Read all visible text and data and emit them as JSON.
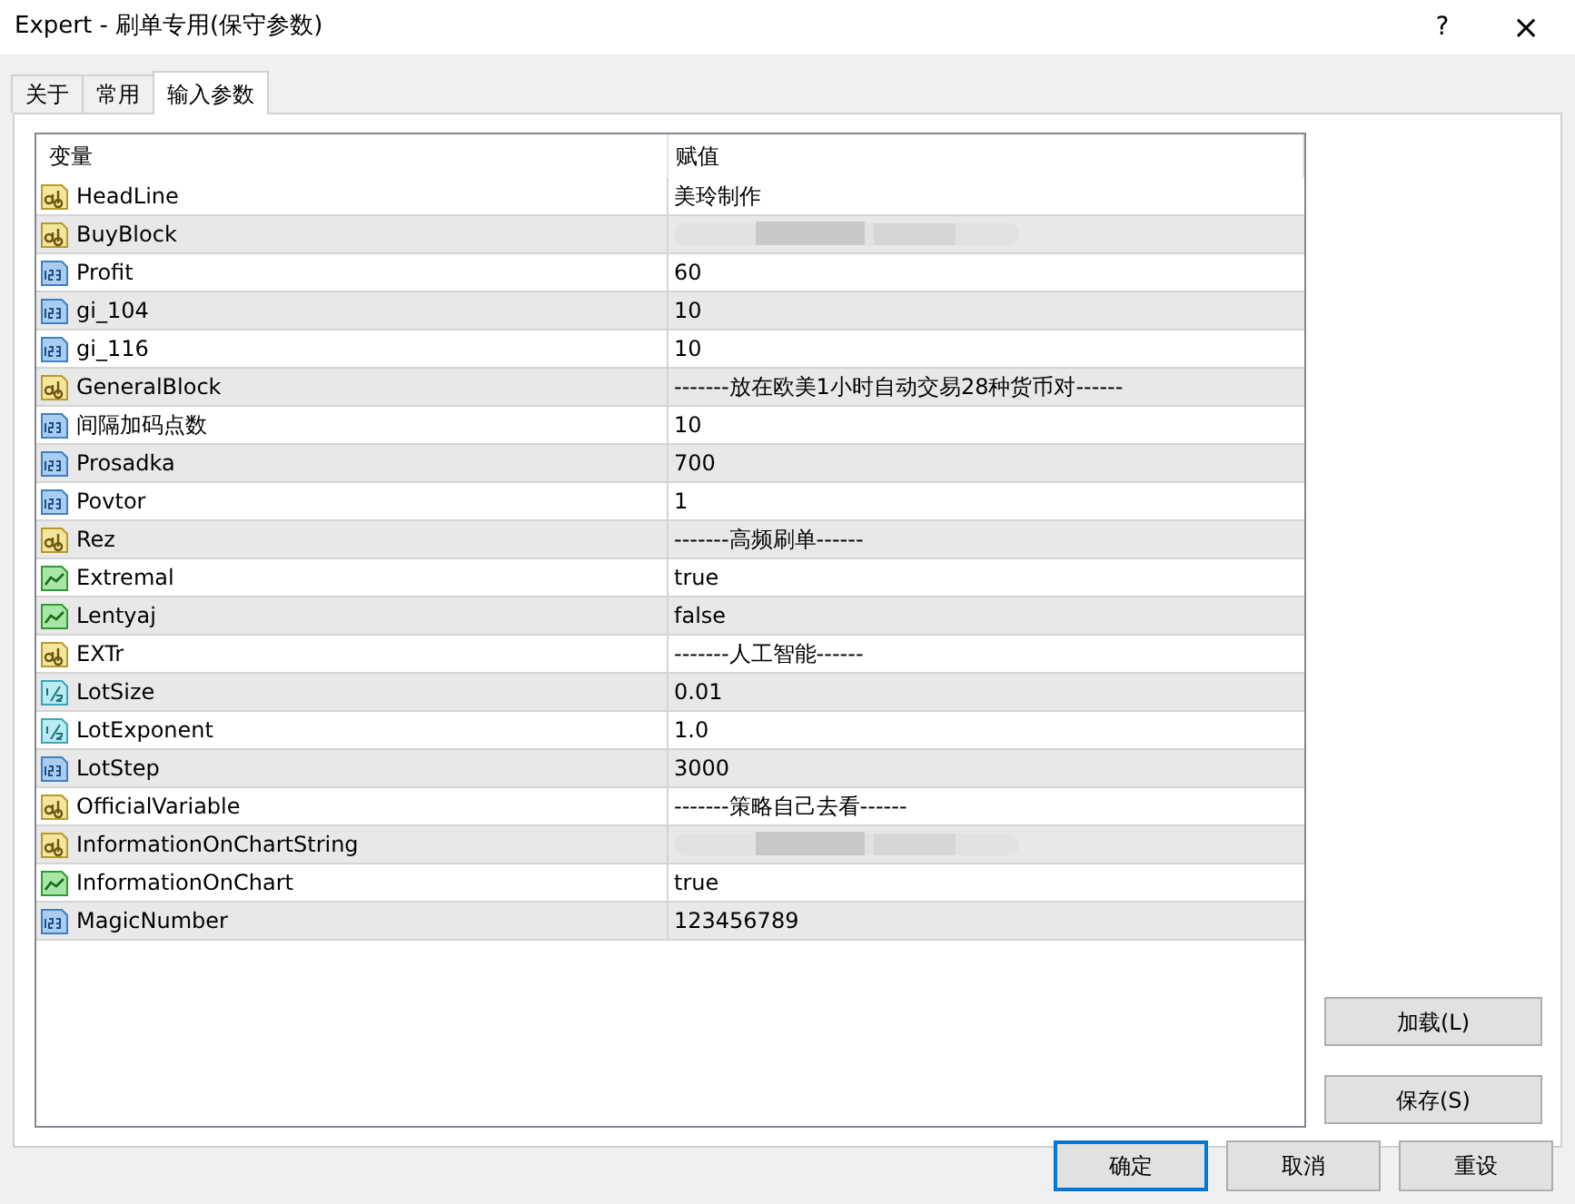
{
  "window": {
    "title": "Expert - 刷单专用(保守参数)",
    "help": "?",
    "close": "×"
  },
  "tabs": [
    {
      "label": "关于",
      "selected": false
    },
    {
      "label": "常用",
      "selected": false
    },
    {
      "label": "输入参数",
      "selected": true
    }
  ],
  "table": {
    "columns": [
      "变量",
      "赋值"
    ],
    "rows": [
      {
        "kind": "string",
        "name": "HeadLine",
        "value": "美玲制作"
      },
      {
        "kind": "string",
        "name": "BuyBlock",
        "redacted": true
      },
      {
        "kind": "int",
        "name": "Profit",
        "value": "60"
      },
      {
        "kind": "int",
        "name": "gi_104",
        "value": "10"
      },
      {
        "kind": "int",
        "name": "gi_116",
        "value": "10"
      },
      {
        "kind": "string",
        "name": "GeneralBlock",
        "value": "-------放在欧美1小时自动交易28种货币对------"
      },
      {
        "kind": "int",
        "name": "间隔加码点数",
        "value": "10"
      },
      {
        "kind": "int",
        "name": "Prosadka",
        "value": "700"
      },
      {
        "kind": "int",
        "name": "Povtor",
        "value": "1"
      },
      {
        "kind": "string",
        "name": "Rez",
        "value": "-------高频刷单------"
      },
      {
        "kind": "bool",
        "name": "Extremal",
        "value": "true"
      },
      {
        "kind": "bool",
        "name": "Lentyaj",
        "value": "false"
      },
      {
        "kind": "string",
        "name": "EXTr",
        "value": "-------人工智能------"
      },
      {
        "kind": "double",
        "name": "LotSize",
        "value": "0.01"
      },
      {
        "kind": "double",
        "name": "LotExponent",
        "value": "1.0"
      },
      {
        "kind": "int",
        "name": "LotStep",
        "value": "3000"
      },
      {
        "kind": "string",
        "name": "OfficialVariable",
        "value": "-------策略自己去看------"
      },
      {
        "kind": "string",
        "name": "InformationOnChartString",
        "redacted": true
      },
      {
        "kind": "bool",
        "name": "InformationOnChart",
        "value": "true"
      },
      {
        "kind": "int",
        "name": "MagicNumber",
        "value": "123456789"
      }
    ]
  },
  "side_buttons": [
    "加载(L)",
    "保存(S)"
  ],
  "footer_buttons": [
    {
      "label": "确定",
      "default": true
    },
    {
      "label": "取消",
      "default": false
    },
    {
      "label": "重设",
      "default": false
    }
  ]
}
